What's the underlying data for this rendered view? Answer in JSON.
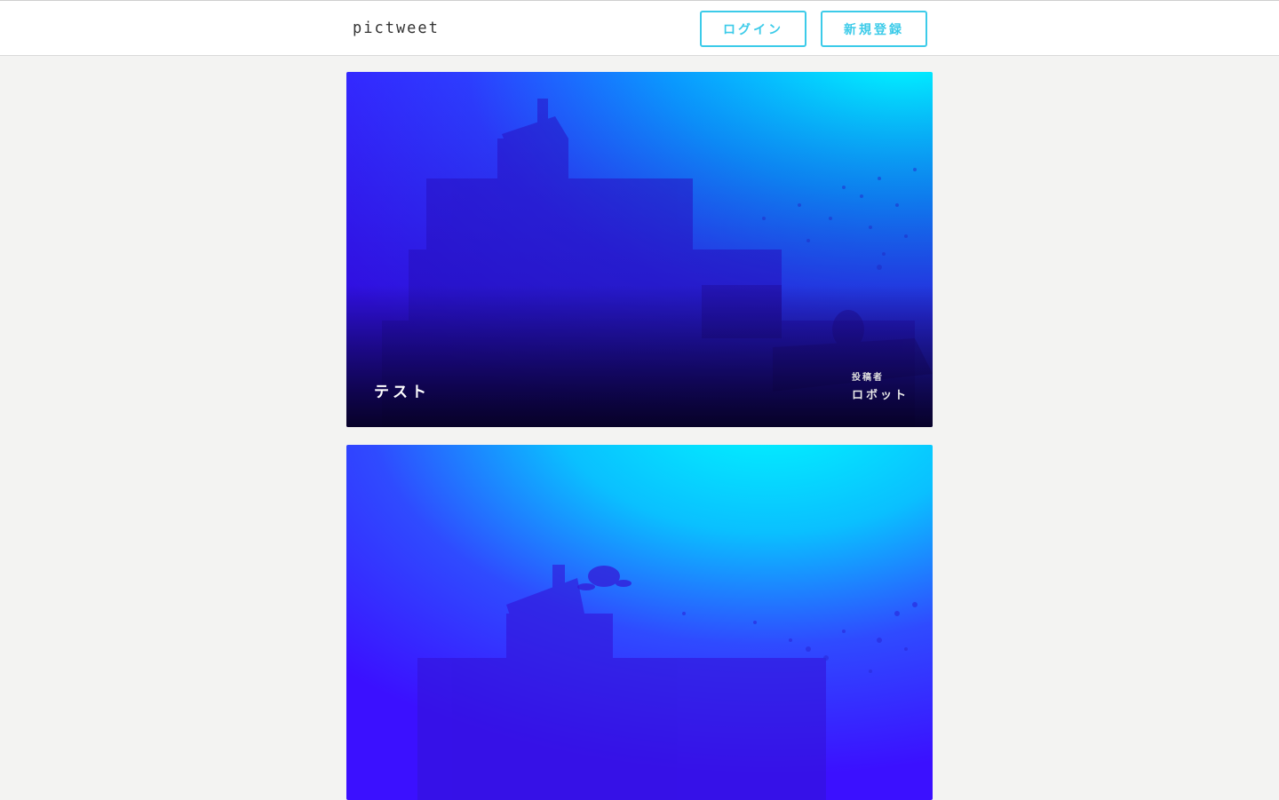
{
  "header": {
    "logo_text": "PICTWEET",
    "login_label": "ログイン",
    "signup_label": "新規登録"
  },
  "posts": [
    {
      "title": "テスト",
      "author_label": "投稿者",
      "author_name": "ロボット",
      "image": "underwater-shipwreck-photo"
    },
    {
      "image": "underwater-turtle-photo"
    }
  ],
  "colors": {
    "accent": "#3ccbe9",
    "background": "#f3f3f2"
  }
}
